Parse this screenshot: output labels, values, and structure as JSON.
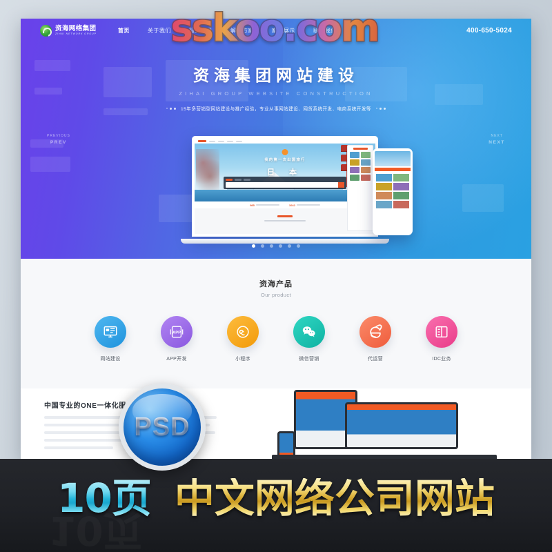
{
  "watermark": {
    "text": "sskoo.com"
  },
  "site": {
    "nav": {
      "brand_cn": "资海网络集团",
      "brand_en": "ZIHAI NETWORK GROUP",
      "items": [
        {
          "label": "首页"
        },
        {
          "label": "关于我们"
        },
        {
          "label": "服务项目"
        },
        {
          "label": "解决方案"
        },
        {
          "label": "案例展示"
        },
        {
          "label": "联系我们"
        }
      ],
      "phone": "400-650-5024"
    },
    "hero": {
      "headline_cn": "资海集团网站建设",
      "headline_en": "ZIHAI GROUP WEBSITE CONSTRUCTION",
      "subtitle": "15年多营销型网站建设与推广经验，专业从事网站建设、网货系统开发、电商系统开发等",
      "prev_small": "PREVIOUS",
      "prev_label": "PREV",
      "next_small": "NEXT",
      "next_label": "NEXT",
      "dots_count": 6,
      "active_dot": 0,
      "mockup": {
        "title_small": "我的第一次出国旅行",
        "title_big": "日 本",
        "stat1": "985",
        "stat2": "1042"
      }
    },
    "products": {
      "title_cn": "资海产品",
      "title_en": "Our product",
      "items": [
        {
          "label": "网站建设",
          "icon": "monitor-icon",
          "color": "#2aa3e8"
        },
        {
          "label": "APP开发",
          "icon": "app-icon",
          "color": "#9a6ce8"
        },
        {
          "label": "小程序",
          "icon": "miniprogram-icon",
          "color": "#f7a81b"
        },
        {
          "label": "微信营销",
          "icon": "wechat-icon",
          "color": "#17c2b0"
        },
        {
          "label": "代运营",
          "icon": "explorer-icon",
          "color": "#f4714f"
        },
        {
          "label": "IDC业务",
          "icon": "server-icon",
          "color": "#f0529b"
        }
      ]
    },
    "bottom": {
      "heading": "中国专业的ONE一体化服务商",
      "paragraph_lines": 5
    }
  },
  "psd_badge": {
    "label": "PSD"
  },
  "banner": {
    "pages": "10页",
    "title": "中文网络公司网站",
    "ghost": "10页"
  },
  "colors": {
    "hero_start": "#6a41ea",
    "hero_end": "#2aa1e2",
    "banner_bg": "#1f2126",
    "gold": "#d8ad34",
    "cyan": "#24b4d8"
  }
}
